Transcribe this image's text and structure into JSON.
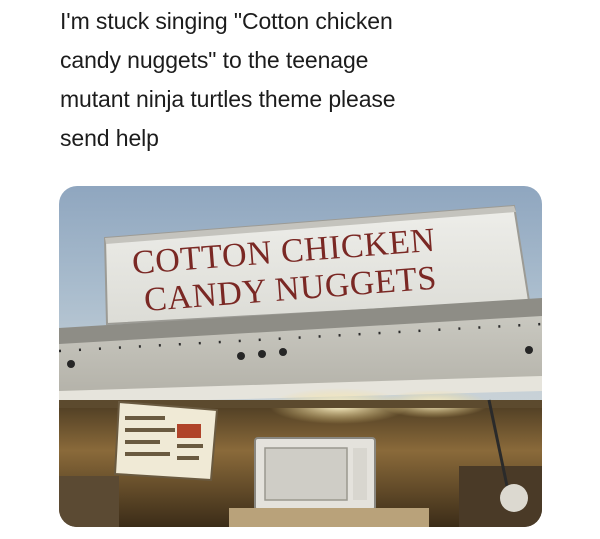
{
  "post": {
    "caption_lines": [
      "I'm stuck singing \"Cotton chicken",
      "candy nuggets\" to the teenage",
      "mutant ninja turtles theme please",
      "send help"
    ]
  },
  "photo": {
    "sign_line_1": "COTTON CHICKEN",
    "sign_line_2": "CANDY NUGGETS"
  }
}
